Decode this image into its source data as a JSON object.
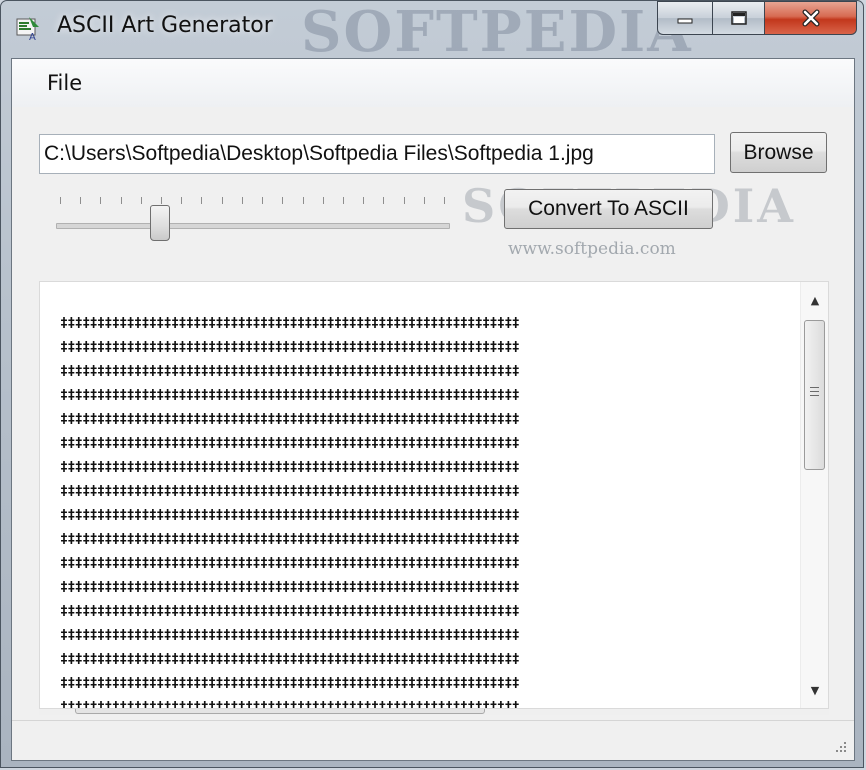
{
  "window": {
    "title": "ASCII Art Generator",
    "watermark_title": "SOFTPEDIA",
    "icon": "app-icon"
  },
  "menu": {
    "items": [
      {
        "label": "File"
      }
    ]
  },
  "toolbar": {
    "file_path": "C:\\Users\\Softpedia\\Desktop\\Softpedia Files\\Softpedia 1.jpg",
    "browse_label": "Browse",
    "convert_label": "Convert To ASCII"
  },
  "slider": {
    "ticks": 20,
    "value_fraction": 0.26
  },
  "watermark": {
    "logo": "SOFTPEDIA",
    "url": "www.softpedia.com"
  },
  "output": {
    "glyph": "‡",
    "rows": 17,
    "cols": 62
  },
  "colors": {
    "close_button": "#c2371c",
    "frame": "#b7c1cc",
    "client": "#f0f0f0"
  }
}
